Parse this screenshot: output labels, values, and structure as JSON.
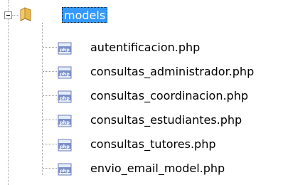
{
  "tree": {
    "root": {
      "label": "models",
      "expander": "minus",
      "icon": "folder-icon",
      "selected": true
    },
    "children": [
      {
        "label": "autentificacion.php",
        "icon": "php-file-icon"
      },
      {
        "label": "consultas_administrador.php",
        "icon": "php-file-icon"
      },
      {
        "label": "consultas_coordinacion.php",
        "icon": "php-file-icon"
      },
      {
        "label": "consultas_estudiantes.php",
        "icon": "php-file-icon"
      },
      {
        "label": "consultas_tutores.php",
        "icon": "php-file-icon"
      },
      {
        "label": "envio_email_model.php",
        "icon": "php-file-icon"
      }
    ]
  },
  "colors": {
    "selection_bg": "#3399ff",
    "selection_text": "#ffffff",
    "tree_line": "#a0a0a0",
    "folder": "#e8b84a",
    "php_icon": "#6b7fb8"
  }
}
